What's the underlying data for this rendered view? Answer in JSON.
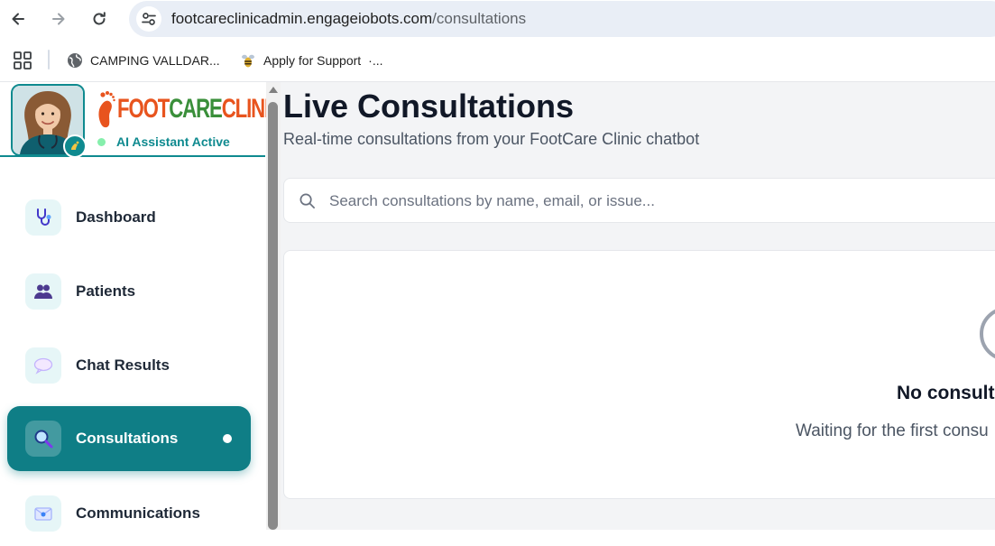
{
  "browser": {
    "url_host": "footcareclinicadmin.engageiobots.com",
    "url_path": "/consultations",
    "bookmarks": [
      {
        "label": "CAMPING VALLDAR...",
        "icon": "globe-icon"
      },
      {
        "label": "Apply for Support",
        "icon": "bee-icon"
      }
    ],
    "more_label": "·..."
  },
  "sidebar": {
    "logo": {
      "part1": "FOOT",
      "part2": "CARE",
      "part3": "CLINIC"
    },
    "status_label": "AI Assistant Active",
    "items": [
      {
        "label": "Dashboard",
        "icon": "stethoscope-icon"
      },
      {
        "label": "Patients",
        "icon": "people-icon"
      },
      {
        "label": "Chat Results",
        "icon": "speech-bubble-icon"
      },
      {
        "label": "Consultations",
        "icon": "magnifier-icon",
        "active": true
      },
      {
        "label": "Communications",
        "icon": "envelope-icon"
      }
    ]
  },
  "main": {
    "title": "Live Consultations",
    "subtitle": "Real-time consultations from your FootCare Clinic chatbot",
    "search_placeholder": "Search consultations by name, email, or issue...",
    "empty_title": "No consult",
    "empty_text": "Waiting for the first consu"
  },
  "colors": {
    "accent": "#0f7e86",
    "logo_orange": "#e8541e",
    "logo_green": "#3a8f3a",
    "status_dot": "#86efac"
  }
}
